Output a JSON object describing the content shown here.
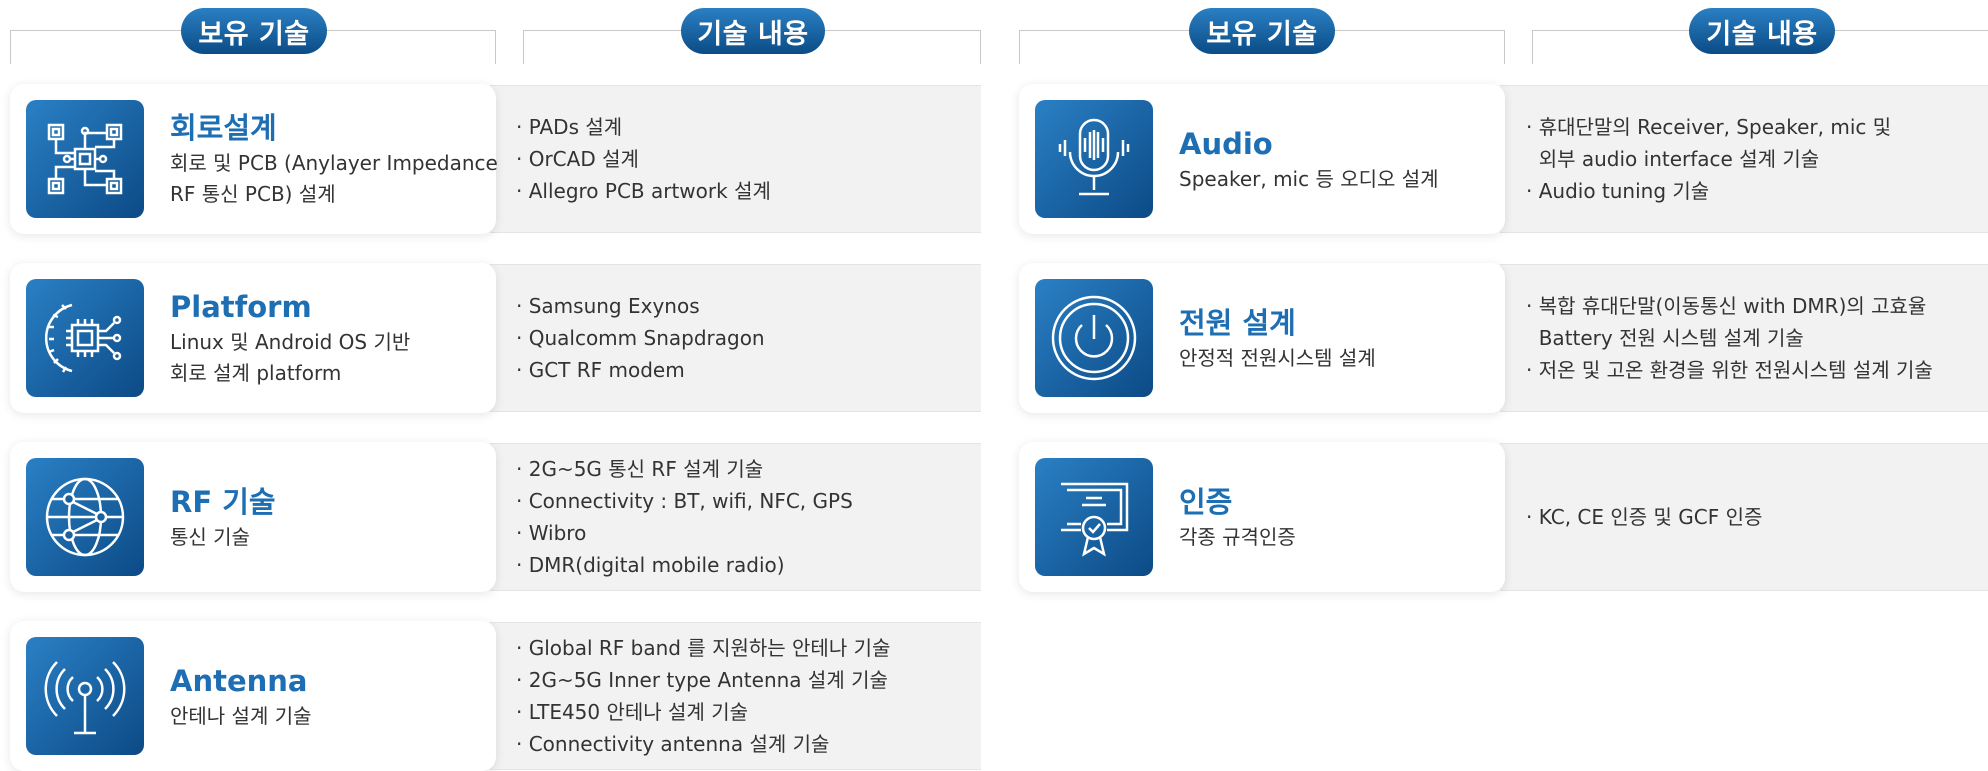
{
  "headers": {
    "left_owned": "보유 기술",
    "left_content": "기술 내용",
    "right_owned": "보유 기술",
    "right_content": "기술 내용"
  },
  "left_rows": [
    {
      "icon": "circuit-icon",
      "title": "회로설계",
      "desc": [
        "회로 및 PCB (Anylayer Impedance",
        "RF 통신 PCB) 설계"
      ],
      "details": [
        "· PADs 설계",
        "· OrCAD 설계",
        "· Allegro PCB artwork 설계"
      ]
    },
    {
      "icon": "chip-gear-icon",
      "title": "Platform",
      "desc": [
        "Linux 및 Android OS 기반",
        "회로 설계 platform"
      ],
      "details": [
        "· Samsung Exynos",
        "· Qualcomm Snapdragon",
        "· GCT RF modem"
      ]
    },
    {
      "icon": "globe-icon",
      "title": "RF 기술",
      "desc": [
        "통신 기술"
      ],
      "details": [
        "· 2G~5G 통신 RF 설계 기술",
        "· Connectivity : BT, wifi, NFC, GPS",
        "· Wibro",
        "· DMR(digital mobile radio)"
      ]
    },
    {
      "icon": "antenna-icon",
      "title": "Antenna",
      "desc": [
        "안테나 설계 기술"
      ],
      "details": [
        "· Global RF band 를 지원하는 안테나 기술",
        "· 2G~5G Inner type Antenna 설계 기술",
        "· LTE450 안테나 설계 기술",
        "· Connectivity antenna 설계 기술"
      ]
    }
  ],
  "right_rows": [
    {
      "icon": "microphone-icon",
      "title": "Audio",
      "desc": [
        "Speaker, mic 등 오디오 설계"
      ],
      "details": [
        "· 휴대단말의 Receiver, Speaker, mic 및",
        "  외부 audio interface 설계 기술",
        "· Audio tuning 기술"
      ]
    },
    {
      "icon": "power-icon",
      "title": "전원 설계",
      "desc": [
        "안정적 전원시스템 설계"
      ],
      "details": [
        "· 복합 휴대단말(이동통신 with DMR)의 고효율",
        "  Battery 전원 시스템 설계 기술",
        "· 저온 및 고온 환경을 위한 전원시스템 설계 기술"
      ]
    },
    {
      "icon": "certificate-icon",
      "title": "인증",
      "desc": [
        "각종 규격인증"
      ],
      "details": [
        "· KC, CE 인증 및 GCF 인증"
      ]
    }
  ]
}
